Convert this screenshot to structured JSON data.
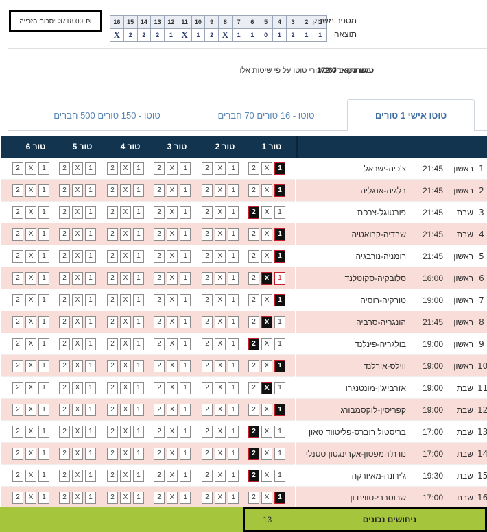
{
  "prize": {
    "label": "סכום הזכייה:",
    "amount": "3718.00",
    "currency": "₪"
  },
  "grid": {
    "game_label": "מספר משחק",
    "result_label": "תוצאה",
    "game_numbers": [
      "16",
      "15",
      "14",
      "13",
      "12",
      "11",
      "10",
      "9",
      "8",
      "7",
      "6",
      "5",
      "4",
      "3",
      "2",
      "1"
    ],
    "results": [
      "X",
      "2",
      "2",
      "2",
      "1",
      "X",
      "1",
      "2",
      "X",
      "1",
      "1",
      "0",
      "1",
      "2",
      "1",
      "1"
    ]
  },
  "summary": {
    "name": "טוטו סמארט 172",
    "text_pre": "משתתף ב",
    "count": "167",
    "text_post": "טורי טוטו על פי שיטות אלו:"
  },
  "tabs": [
    {
      "label": "טוטו אישי 1 טורים",
      "active": true
    },
    {
      "label": "טוטו - 16 טורים 70 חברים",
      "active": false
    },
    {
      "label": "טוטו - 150 טורים 500 חברים",
      "active": false
    }
  ],
  "columns": [
    "1 טור",
    "2 טור",
    "3 טור",
    "4 טור",
    "5 טור",
    "6 טור"
  ],
  "option_labels": [
    "1",
    "X",
    "2"
  ],
  "rows": [
    {
      "n": "1",
      "day": "ראשון",
      "time": "21:45",
      "match": "צ'כיה-ישראל",
      "sel": "1"
    },
    {
      "n": "2",
      "day": "ראשון",
      "time": "21:45",
      "match": "בלגיה-אנגליה",
      "sel": "1"
    },
    {
      "n": "3",
      "day": "שבת",
      "time": "21:45",
      "match": "פורטוגל-צרפת",
      "sel": "2"
    },
    {
      "n": "4",
      "day": "שבת",
      "time": "21:45",
      "match": "שבדיה-קרואטיה",
      "sel": "1"
    },
    {
      "n": "5",
      "day": "ראשון",
      "time": "21:45",
      "match": "רומניה-נורבגיה",
      "sel": "1"
    },
    {
      "n": "6",
      "day": "ראשון",
      "time": "16:00",
      "match": "סלובקיה-סקוטלנד",
      "sel": "X"
    },
    {
      "n": "7",
      "day": "ראשון",
      "time": "19:00",
      "match": "טורקיה-רוסיה",
      "sel": "1"
    },
    {
      "n": "8",
      "day": "ראשון",
      "time": "21:45",
      "match": "הונגריה-סרביה",
      "sel": "X"
    },
    {
      "n": "9",
      "day": "ראשון",
      "time": "19:00",
      "match": "בולגריה-פינלנד",
      "sel": "2"
    },
    {
      "n": "10",
      "day": "ראשון",
      "time": "19:00",
      "match": "ווילס-אירלנד",
      "sel": "1"
    },
    {
      "n": "11",
      "day": "שבת",
      "time": "19:00",
      "match": "אזרבייג'ן-מונטנגרו",
      "sel": "X"
    },
    {
      "n": "12",
      "day": "שבת",
      "time": "19:00",
      "match": "קפריסין-לוקסמבורג",
      "sel": "1"
    },
    {
      "n": "13",
      "day": "שבת",
      "time": "17:00",
      "match": "בריסטול רוברס-פליטווד טאון",
      "sel": "2"
    },
    {
      "n": "14",
      "day": "שבת",
      "time": "17:00",
      "match": "נורת'המפטון-אקרינגטון סטנלי",
      "sel": "2"
    },
    {
      "n": "15",
      "day": "שבת",
      "time": "19:30",
      "match": "ג'ירונה-מאיורקה",
      "sel": "2"
    },
    {
      "n": "16",
      "day": "שבת",
      "time": "17:00",
      "match": "שרוסברי-סווינדון",
      "sel": "1"
    }
  ],
  "footer": {
    "label": "ניחושים נכונים",
    "value": "13"
  }
}
